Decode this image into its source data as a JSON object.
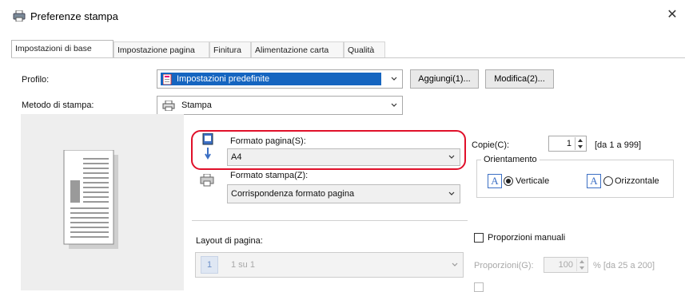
{
  "window": {
    "title": "Preferenze stampa",
    "close_glyph": "✕"
  },
  "tabs": [
    {
      "label": "Impostazioni di base",
      "active": true
    },
    {
      "label": "Impostazione pagina",
      "active": false
    },
    {
      "label": "Finitura",
      "active": false
    },
    {
      "label": "Alimentazione carta",
      "active": false
    },
    {
      "label": "Qualità",
      "active": false
    }
  ],
  "profile": {
    "label": "Profilo:",
    "value": "Impostazioni predefinite",
    "add_button": "Aggiungi(1)...",
    "edit_button": "Modifica(2)..."
  },
  "print_method": {
    "label": "Metodo di stampa:",
    "value": "Stampa"
  },
  "page_size": {
    "label": "Formato pagina(S):",
    "value": "A4"
  },
  "output_size": {
    "label": "Formato stampa(Z):",
    "value": "Corrispondenza formato pagina"
  },
  "copies": {
    "label": "Copie(C):",
    "value": "1",
    "range": "[da 1 a 999]"
  },
  "orientation": {
    "label": "Orientamento",
    "options": [
      {
        "label": "Verticale",
        "selected": true
      },
      {
        "label": "Orizzontale",
        "selected": false
      }
    ],
    "icon_letter": "A"
  },
  "layout": {
    "label": "Layout di pagina:",
    "value": "1 su 1",
    "icon_number": "1"
  },
  "manual_scale": {
    "label": "Proporzioni manuali",
    "scale_label": "Proporzioni(G):",
    "scale_value": "100",
    "scale_range": "% [da 25 a 200]"
  },
  "colors": {
    "highlight": "#e0102a",
    "profile_selection": "#1565c0"
  }
}
